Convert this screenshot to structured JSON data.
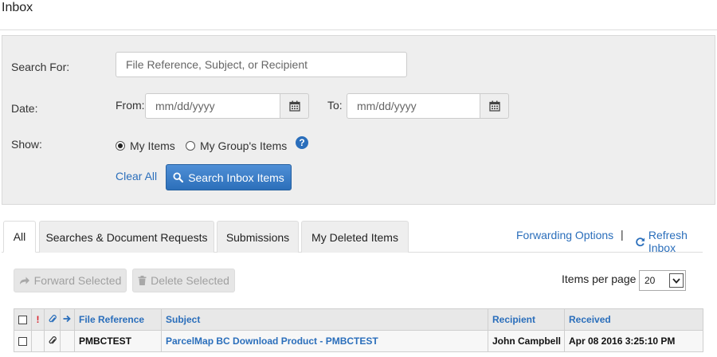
{
  "page": {
    "title": "Inbox"
  },
  "search": {
    "search_for_label": "Search For:",
    "search_placeholder": "File Reference, Subject, or Recipient",
    "date_label": "Date:",
    "from_label": "From:",
    "from_placeholder": "mm/dd/yyyy",
    "to_label": "To:",
    "to_placeholder": "mm/dd/yyyy",
    "show_label": "Show:",
    "option_my_items": "My Items",
    "option_group_items": "My Group's Items",
    "selected_option": "My Items",
    "clear_all": "Clear All",
    "search_button": "Search Inbox Items"
  },
  "tabs": [
    {
      "label": "All",
      "active": true
    },
    {
      "label": "Searches & Document Requests",
      "active": false
    },
    {
      "label": "Submissions",
      "active": false
    },
    {
      "label": "My Deleted Items",
      "active": false
    }
  ],
  "header_links": {
    "forwarding_options": "Forwarding Options",
    "separator": "|",
    "refresh_inbox": "Refresh Inbox"
  },
  "toolbar": {
    "forward_selected": "Forward Selected",
    "delete_selected": "Delete Selected",
    "items_per_page_label": "Items per page",
    "items_per_page_value": "20"
  },
  "table": {
    "columns": {
      "priority": "!",
      "file_reference": "File Reference",
      "subject": "Subject",
      "recipient": "Recipient",
      "received": "Received"
    },
    "rows": [
      {
        "file_reference": "PMBCTEST",
        "subject": "ParcelMap BC Download Product - PMBCTEST",
        "recipient": "John Campbell",
        "received": "Apr 08 2016 3:25:10 PM"
      }
    ]
  },
  "colors": {
    "accent": "#2a6ebb",
    "priority": "#d9232d",
    "panel_bg": "#eeeeee"
  },
  "icons": [
    "calendar-icon",
    "search-icon",
    "help-icon",
    "forward-icon",
    "trash-icon",
    "refresh-icon",
    "paperclip-icon",
    "arrow-right-icon",
    "chevron-down-icon"
  ]
}
